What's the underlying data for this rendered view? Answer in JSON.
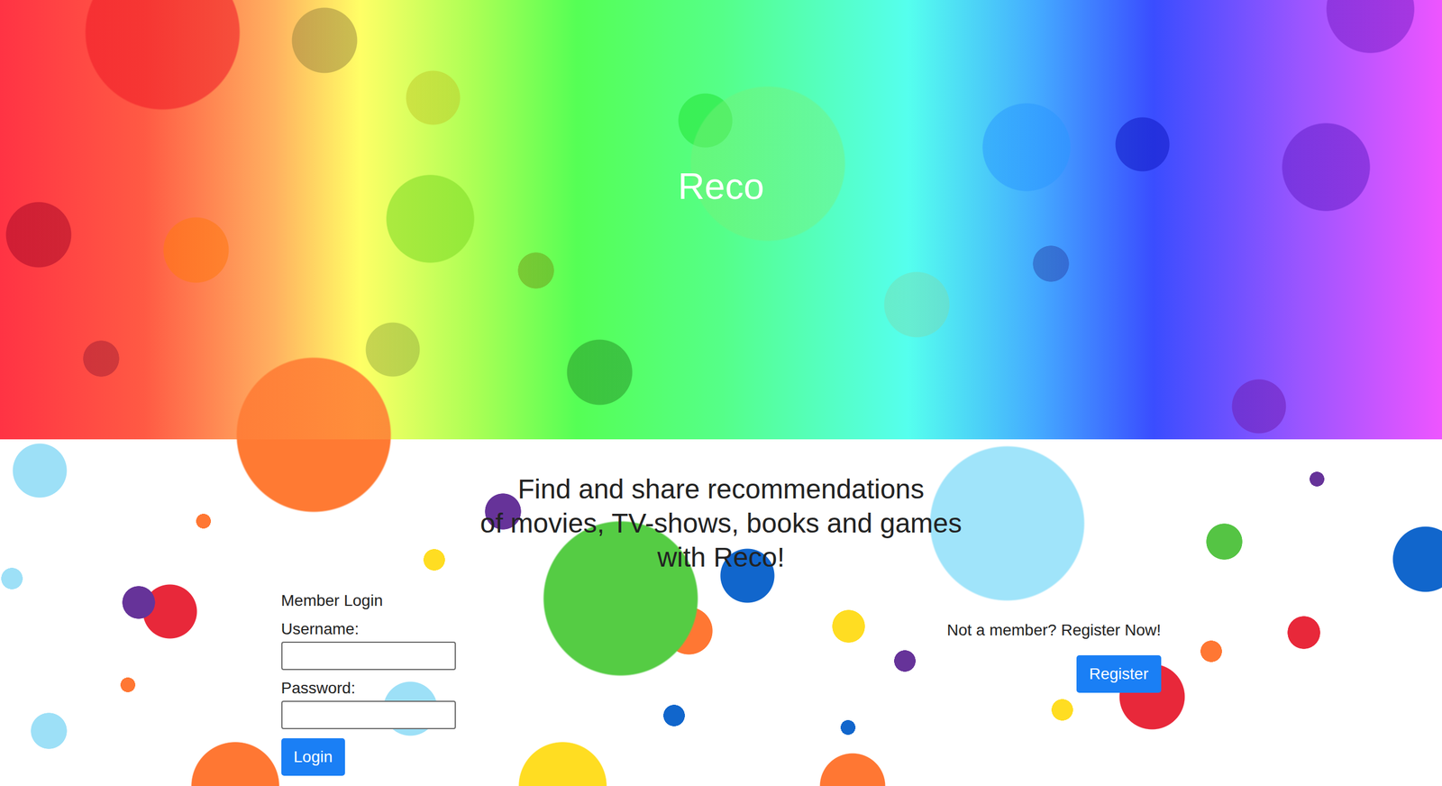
{
  "title": "Reco",
  "tagline": [
    "Find and share recommendations",
    "of movies, TV-shows, books and games",
    "with Reco!"
  ],
  "login": {
    "heading": "Member Login",
    "fields": [
      {
        "label": "Username:",
        "kind": "text",
        "value": ""
      },
      {
        "label": "Password:",
        "kind": "password",
        "value": ""
      }
    ],
    "button": "Login"
  },
  "register": {
    "prompt": "Not a member? Register Now!",
    "button": "Register"
  }
}
